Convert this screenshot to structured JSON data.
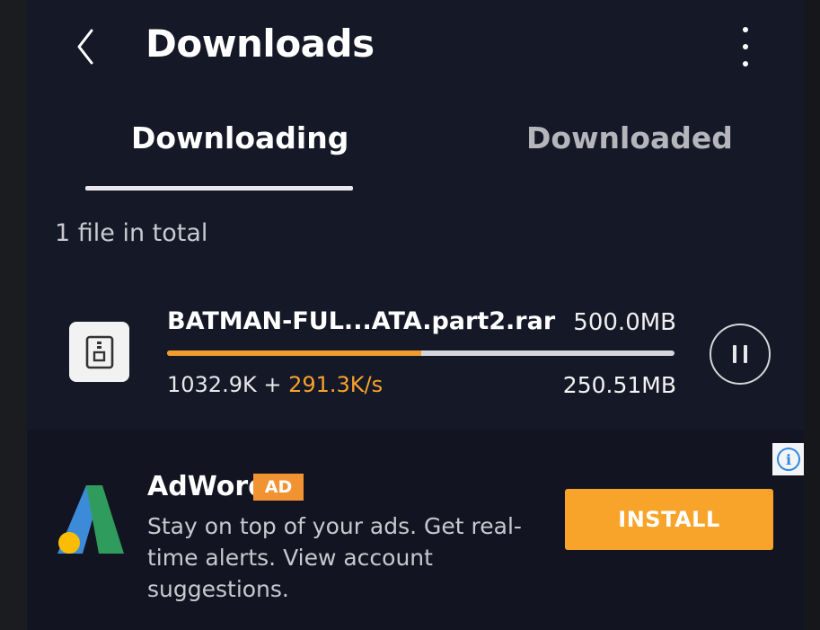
{
  "header": {
    "title": "Downloads",
    "back_icon": "chevron-left-icon",
    "menu_icon": "more-vertical-icon"
  },
  "tabs": [
    {
      "label": "Downloading",
      "active": true
    },
    {
      "label": "Downloaded",
      "active": false
    }
  ],
  "summary": {
    "total_text": "1 file in total"
  },
  "download": {
    "file_icon": "zip-archive-icon",
    "name": "BATMAN-FUL...ATA.part2.rar",
    "total_size": "500.0MB",
    "progress_fraction": 0.5,
    "speed_prefix": "1032.9K + ",
    "speed_rate": "291.3K/s",
    "downloaded_size": "250.51MB",
    "pause_icon": "pause-icon"
  },
  "ad": {
    "info_icon": "info-icon",
    "logo_icon": "adwords-logo-icon",
    "brand": "AdWords",
    "badge": "AD",
    "description": "Stay on top of your ads. Get real-time alerts. View account suggestions.",
    "install_label": "INSTALL"
  },
  "colors": {
    "accent_orange": "#f8a42a",
    "progress_fill": "#f29b2f",
    "background": "#151826",
    "info_blue": "#2d8be0"
  }
}
